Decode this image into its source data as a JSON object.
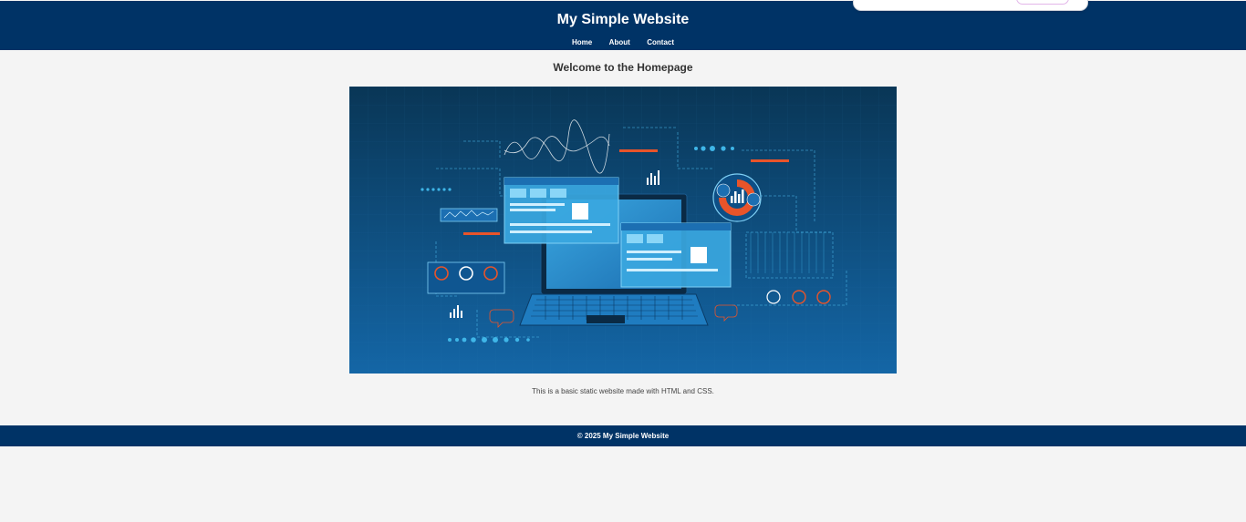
{
  "header": {
    "title": "My Simple Website",
    "nav": [
      {
        "label": "Home"
      },
      {
        "label": "About"
      },
      {
        "label": "Contact"
      }
    ]
  },
  "main": {
    "heading": "Welcome to the Homepage",
    "hero": {
      "subject": "laptop with analytics dashboards illustration"
    },
    "description": "This is a basic static website made with HTML and CSS."
  },
  "footer": {
    "text": "© 2025 My Simple Website"
  },
  "colors": {
    "header_bg": "#003366",
    "page_bg": "#f4f4f4",
    "hero_bg": "#0b3b62",
    "accent_orange": "#e8542a",
    "accent_cyan": "#3fb6e8"
  }
}
